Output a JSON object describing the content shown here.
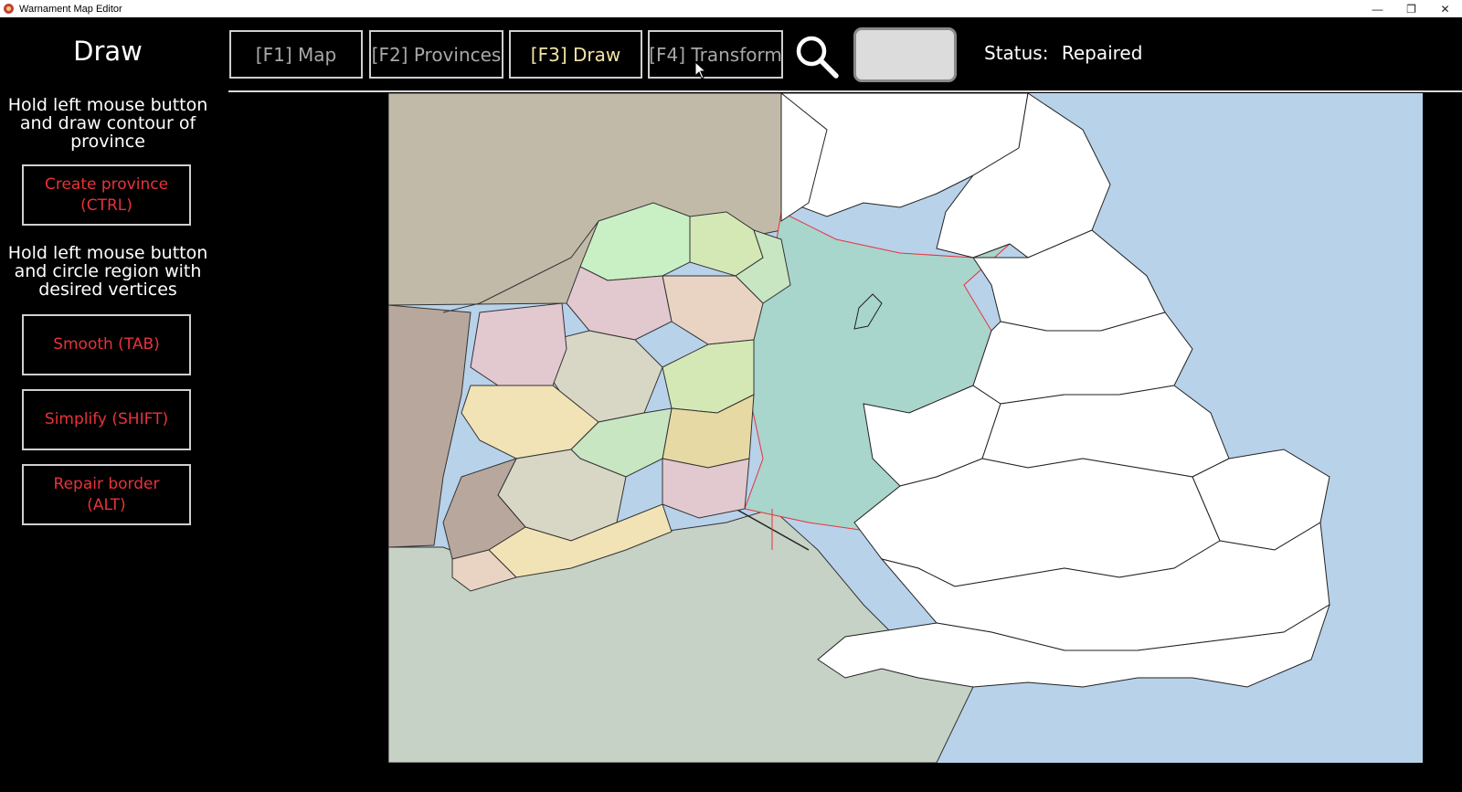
{
  "window": {
    "title": "Warnament Map Editor",
    "minimize_glyph": "—",
    "maximize_glyph": "❐",
    "close_glyph": "✕"
  },
  "sidebar": {
    "title": "Draw",
    "instruction_1": "Hold left mouse button and draw contour of province",
    "create_button": {
      "line1": "Create province",
      "line2": "(CTRL)"
    },
    "instruction_2": "Hold left mouse button and circle region with desired vertices",
    "smooth_button": {
      "line1": "Smooth (TAB)"
    },
    "simplify_button": {
      "line1": "Simplify (SHIFT)"
    },
    "repair_button": {
      "line1": "Repair border",
      "line2": "(ALT)"
    }
  },
  "toolbar": {
    "tabs": [
      {
        "label": "[F1] Map",
        "active": false
      },
      {
        "label": "[F2] Provinces",
        "active": false
      },
      {
        "label": "[F3] Draw",
        "active": true
      },
      {
        "label": "[F4] Transform",
        "active": false
      }
    ],
    "search_icon": "magnifier-icon",
    "selected_color": "#dcdcdc",
    "status_label": "Status:",
    "status_value": "Repaired"
  },
  "map": {
    "colors": {
      "sea": "#b8d2ea",
      "irish_sea_selection": "#a8d5cc",
      "ireland_provinces": [
        "#c9f0c4",
        "#e9d4c4",
        "#f1e3b5",
        "#d4e8b5",
        "#e2c8cf",
        "#c8e6c1",
        "#e7d9a4",
        "#d8d7c6"
      ],
      "britain_provinces": "#ffffff",
      "neighbor_land": "#c2baa8",
      "repaired_border": "#e8323a"
    }
  }
}
